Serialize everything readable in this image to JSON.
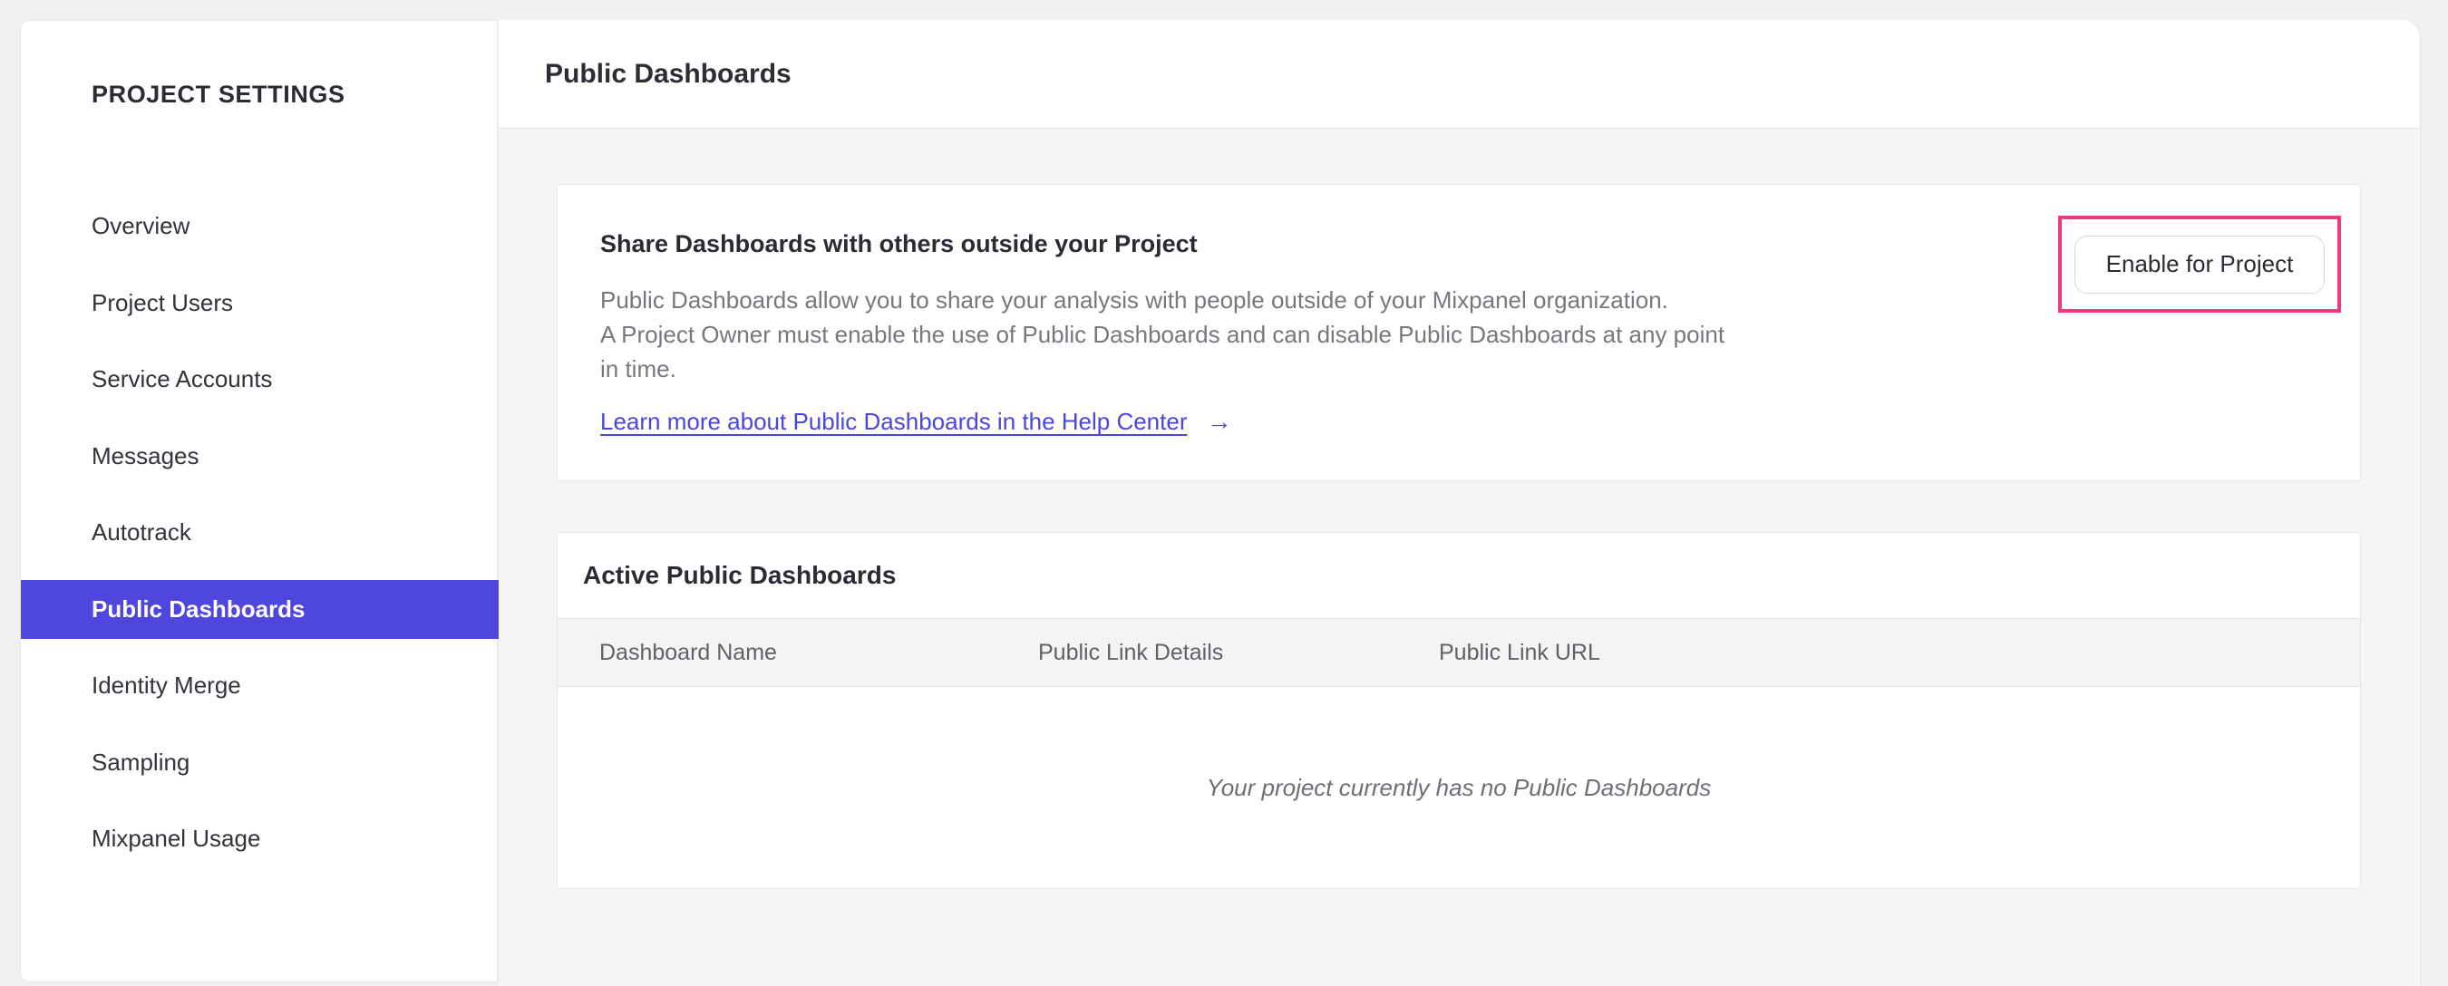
{
  "sidebar": {
    "title": "PROJECT SETTINGS",
    "items": [
      {
        "label": "Overview",
        "selected": false
      },
      {
        "label": "Project Users",
        "selected": false
      },
      {
        "label": "Service Accounts",
        "selected": false
      },
      {
        "label": "Messages",
        "selected": false
      },
      {
        "label": "Autotrack",
        "selected": false
      },
      {
        "label": "Public Dashboards",
        "selected": true
      },
      {
        "label": "Identity Merge",
        "selected": false
      },
      {
        "label": "Sampling",
        "selected": false
      },
      {
        "label": "Mixpanel Usage",
        "selected": false
      }
    ]
  },
  "header": {
    "title": "Public Dashboards"
  },
  "main": {
    "share_card": {
      "heading": "Share Dashboards with others outside your Project",
      "body_lines": [
        "Public Dashboards allow you to share your analysis with people outside of your Mixpanel organization.",
        "A Project Owner must enable the use of Public Dashboards and can disable Public Dashboards at any point",
        "in time."
      ],
      "link_label": "Learn more about Public Dashboards in the Help Center",
      "link_arrow": "→",
      "enable_button_label": "Enable for Project"
    },
    "active_card": {
      "title": "Active Public Dashboards",
      "columns": [
        "Dashboard Name",
        "Public Link Details",
        "Public Link URL"
      ],
      "empty_message": "Your project currently has no Public Dashboards"
    }
  },
  "colors": {
    "accent_purple": "#4f46dd",
    "link_blue": "#4a46df",
    "annotation_pink": "#ee3b80"
  }
}
